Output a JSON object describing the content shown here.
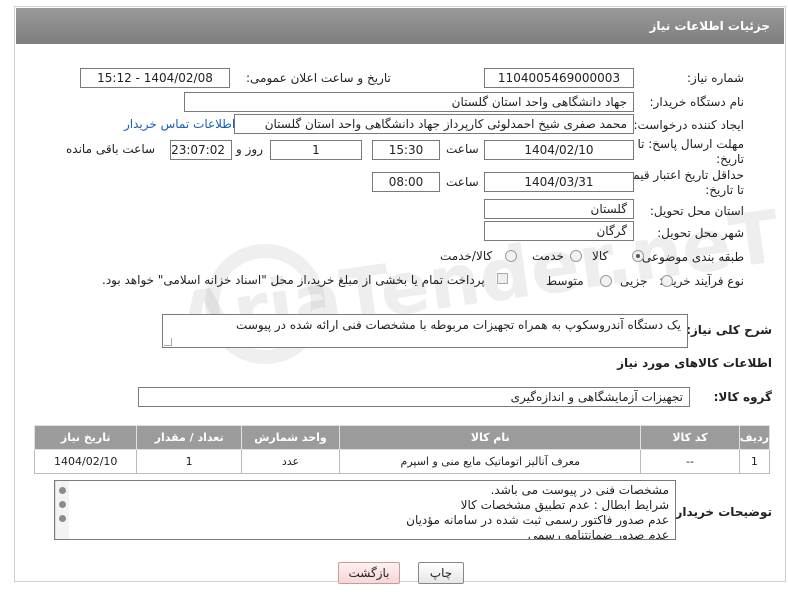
{
  "header": {
    "title": "جزئیات اطلاعات نیاز"
  },
  "form": {
    "need_number_label": "شماره نیاز:",
    "need_number": "1104005469000003",
    "announce_label": "تاریخ و ساعت اعلان عمومی:",
    "announce_value": "1404/02/08 - 15:12",
    "buyer_org_label": "نام دستگاه خریدار:",
    "buyer_org": "جهاد دانشگاهی واحد استان گلستان",
    "requester_label": "ایجاد کننده درخواست:",
    "requester": "محمد صفری شیخ احمدلوئی کارپرداز جهاد دانشگاهی واحد استان گلستان",
    "contact_link": "اطلاعات تماس خریدار",
    "deadline_label_1": "مهلت ارسال پاسخ: تا",
    "deadline_label_2": "تاریخ:",
    "deadline_date": "1404/02/10",
    "time_label": "ساعت",
    "deadline_time": "15:30",
    "days_value": "1",
    "days_label": "روز و",
    "remaining_time": "23:07:02",
    "remaining_label": "ساعت باقی مانده",
    "validity_label_1": "حداقل تاریخ اعتبار قیمت:",
    "validity_label_2": "تا تاریخ:",
    "validity_date": "1404/03/31",
    "validity_time": "08:00",
    "province_label": "استان محل تحویل:",
    "province": "گلستان",
    "city_label": "شهر محل تحویل:",
    "city": "گرگان",
    "category_label": "طبقه بندی موضوعی:",
    "category_options": [
      "کالا",
      "خدمت",
      "کالا/خدمت"
    ],
    "process_label": "نوع فرآیند خرید :",
    "process_options": [
      "جزیی",
      "متوسط"
    ],
    "payment_note": "پرداخت تمام یا بخشی از مبلغ خرید،از محل \"اسناد خزانه اسلامی\" خواهد بود."
  },
  "description": {
    "label": "شرح کلی نیاز:",
    "value": "یک دستگاه آندروسکوپ به همراه تجهیزات مربوطه با مشخصات فنی ارائه شده در پیوست"
  },
  "goods": {
    "section_title": "اطلاعات کالاهای مورد نیاز",
    "group_label": "گروه کالا:",
    "group_value": "تجهیزات آزمایشگاهی و اندازه‌گیری",
    "columns": [
      "ردیف",
      "کد کالا",
      "نام کالا",
      "واحد شمارش",
      "تعداد / مقدار",
      "تاریخ نیاز"
    ],
    "rows": [
      [
        "1",
        "--",
        "معرف آنالیز اتوماتیک مایع منی و اسپرم",
        "عدد",
        "1",
        "1404/02/10"
      ]
    ]
  },
  "notes": {
    "label": "توضیحات خریدار:",
    "lines": [
      "مشخصات فنی در پیوست می باشد.",
      "شرایط ابطال : عدم تطبیق مشخصات کالا",
      "عدم صدور فاکتور رسمی ثبت شده در سامانه مؤدیان",
      " عدم صدور ضمانتنامه رسمی"
    ]
  },
  "buttons": {
    "print": "چاپ",
    "back": "بازگشت"
  },
  "watermark": "AriaTender.neT"
}
